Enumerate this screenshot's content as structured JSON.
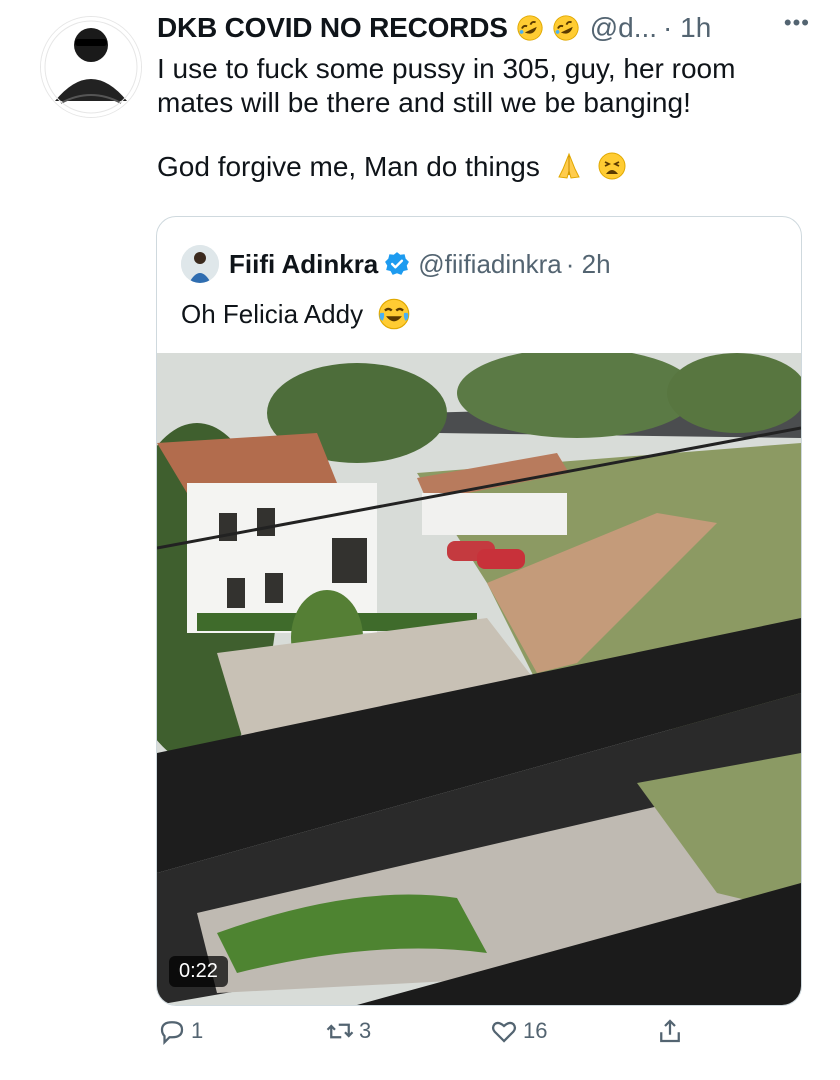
{
  "tweet": {
    "author_name": "DKB COVID NO RECORDS",
    "author_handle": "@d...",
    "timestamp": "· 1h",
    "text_line1": "I use to fuck some pussy in 305, guy, her room",
    "text_line2": "mates will be there and still we be banging!",
    "text_line3": "God forgive me, Man do things",
    "emojis": [
      "rolling-on-floor-laughing",
      "rolling-on-floor-laughing",
      "folded-hands",
      "weary-face"
    ]
  },
  "quoted": {
    "author_name": "Fiifi Adinkra",
    "author_handle": "@fiifiadinkra",
    "timestamp": "· 2h",
    "text": "Oh Felicia Addy",
    "emoji": "face-with-tears-of-joy",
    "media": {
      "type": "video",
      "duration": "0:22"
    }
  },
  "actions": {
    "reply_count": "1",
    "retweet_count": "3",
    "like_count": "16"
  },
  "colors": {
    "text": "#0f1419",
    "secondary": "#536471",
    "border": "#cfd9de",
    "verified": "#1d9bf0"
  }
}
